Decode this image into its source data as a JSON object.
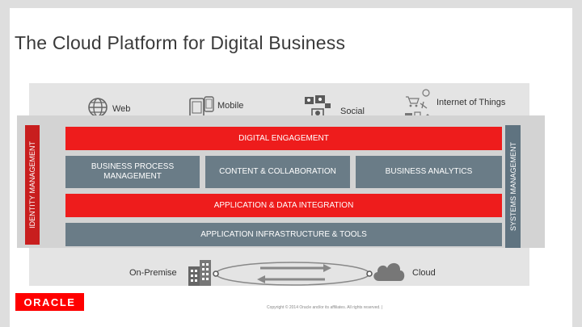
{
  "title": "The Cloud Platform for Digital Business",
  "channels": [
    {
      "label": "Web",
      "icon": "globe-icon"
    },
    {
      "label": "Mobile",
      "icon": "mobile-devices-icon"
    },
    {
      "label": "Social",
      "icon": "social-people-icon"
    },
    {
      "label": "Internet of Things",
      "icon": "iot-devices-icon"
    }
  ],
  "side_labels": {
    "identity": "IDENTITY MANAGEMENT",
    "systems": "SYSTEMS MANAGEMENT"
  },
  "layers": {
    "digital_engagement": "DIGITAL ENGAGEMENT",
    "business_process": "BUSINESS PROCESS MANAGEMENT",
    "content_collab": "CONTENT & COLLABORATION",
    "business_analytics": "BUSINESS ANALYTICS",
    "app_data_integration": "APPLICATION & DATA INTEGRATION",
    "app_infra_tools": "APPLICATION INFRASTRUCTURE & TOOLS"
  },
  "deployment": {
    "on_premise": "On-Premise",
    "cloud": "Cloud"
  },
  "footer": {
    "logo": "ORACLE",
    "copyright": "Copyright © 2014 Oracle and/or its affiliates. All rights reserved.  |"
  },
  "colors": {
    "red": "#ee1c1c",
    "slate": "#6a7c87",
    "oracle_red": "#ff0000"
  }
}
